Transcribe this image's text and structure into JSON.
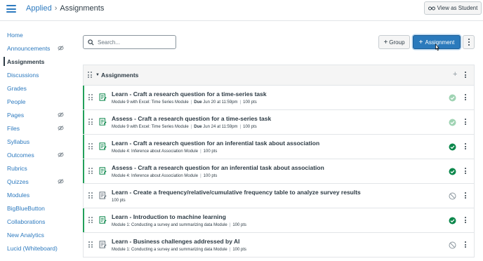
{
  "header": {
    "breadcrumb_course": "Applied",
    "breadcrumb_separator": "›",
    "breadcrumb_current": "Assignments",
    "view_as_student_label": "View as Student"
  },
  "sidebar": {
    "items": [
      {
        "label": "Home",
        "hidden": false,
        "active": false
      },
      {
        "label": "Announcements",
        "hidden": true,
        "active": false
      },
      {
        "label": "Assignments",
        "hidden": false,
        "active": true
      },
      {
        "label": "Discussions",
        "hidden": false,
        "active": false
      },
      {
        "label": "Grades",
        "hidden": false,
        "active": false
      },
      {
        "label": "People",
        "hidden": false,
        "active": false
      },
      {
        "label": "Pages",
        "hidden": true,
        "active": false
      },
      {
        "label": "Files",
        "hidden": true,
        "active": false
      },
      {
        "label": "Syllabus",
        "hidden": false,
        "active": false
      },
      {
        "label": "Outcomes",
        "hidden": true,
        "active": false
      },
      {
        "label": "Rubrics",
        "hidden": false,
        "active": false
      },
      {
        "label": "Quizzes",
        "hidden": true,
        "active": false
      },
      {
        "label": "Modules",
        "hidden": false,
        "active": false
      },
      {
        "label": "BigBlueButton",
        "hidden": false,
        "active": false
      },
      {
        "label": "Collaborations",
        "hidden": false,
        "active": false
      },
      {
        "label": "New Analytics",
        "hidden": false,
        "active": false
      },
      {
        "label": "Lucid (Whiteboard)",
        "hidden": false,
        "active": false
      }
    ]
  },
  "toolbar": {
    "search_placeholder": "Search...",
    "group_button_label": "Group",
    "assignment_button_label": "Assignment"
  },
  "group": {
    "title": "Assignments"
  },
  "assignments": [
    {
      "title": "Learn - Craft a research question for a time-series task",
      "module": "Module 9 with Excel: Time Series Module",
      "due_label": "Due",
      "due": "Jun 20 at 11:59pm",
      "points": "100 pts",
      "status": "published-muted",
      "bar": true
    },
    {
      "title": "Assess - Craft a research question for a time-series task",
      "module": "Module 9 with Excel: Time Series Module",
      "due_label": "Due",
      "due": "Jun 24 at 11:59pm",
      "points": "100 pts",
      "status": "published-muted",
      "bar": true
    },
    {
      "title": "Learn - Craft a research question for an inferential task about association",
      "module": "Module 4: Inference about Association Module",
      "due_label": "",
      "due": "",
      "points": "100 pts",
      "status": "published",
      "bar": true
    },
    {
      "title": "Assess - Craft a research question for an inferential task about association",
      "module": "Module 4: Inference about Association Module",
      "due_label": "",
      "due": "",
      "points": "100 pts",
      "status": "published",
      "bar": true
    },
    {
      "title": "Learn - Create a frequency/relative/cumulative frequency table to analyze survey results",
      "module": "",
      "due_label": "",
      "due": "",
      "points": "100 pts",
      "status": "unpublished",
      "bar": false
    },
    {
      "title": "Learn - Introduction to machine learning",
      "module": "Module 1: Conducting a survey and summarizing data Module",
      "due_label": "",
      "due": "",
      "points": "100 pts",
      "status": "published",
      "bar": true
    },
    {
      "title": "Learn - Business challenges addressed by AI",
      "module": "Module 1: Conducting a survey and summarizing data Module",
      "due_label": "",
      "due": "",
      "points": "100 pts",
      "status": "unpublished",
      "bar": false
    }
  ],
  "colors": {
    "link": "#2d7abf",
    "primary_button": "#2b7abc",
    "published_green": "#0b874b",
    "muted_green": "#9fd3b3",
    "unpublished_gray": "#8b969e"
  }
}
